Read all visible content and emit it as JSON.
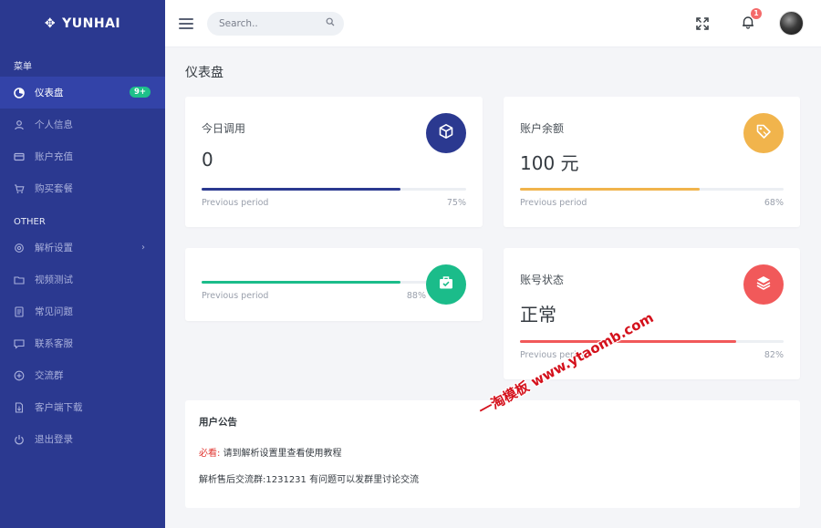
{
  "brand": {
    "name": "YUNHAI",
    "icon": "crosshair-icon"
  },
  "sidebar": {
    "section_menu": "菜单",
    "section_other": "OTHER",
    "menu_items": [
      {
        "label": "仪表盘",
        "icon": "dashboard-icon",
        "badge": "9+",
        "active": true
      },
      {
        "label": "个人信息",
        "icon": "user-icon"
      },
      {
        "label": "账户充值",
        "icon": "credit-card-icon"
      },
      {
        "label": "购买套餐",
        "icon": "cart-icon"
      }
    ],
    "other_items": [
      {
        "label": "解析设置",
        "icon": "gear-icon",
        "has_submenu": true
      },
      {
        "label": "视频测试",
        "icon": "video-icon"
      },
      {
        "label": "常见问题",
        "icon": "document-icon"
      },
      {
        "label": "联系客服",
        "icon": "chat-icon"
      },
      {
        "label": "交流群",
        "icon": "plus-circle-icon"
      },
      {
        "label": "客户端下载",
        "icon": "file-download-icon"
      },
      {
        "label": "退出登录",
        "icon": "power-icon"
      }
    ]
  },
  "topbar": {
    "search_placeholder": "Search..",
    "notification_count": "1"
  },
  "main": {
    "page_title": "仪表盘",
    "cards": [
      {
        "label": "今日调用",
        "value": "0",
        "period_label": "Previous period",
        "percent": "75%",
        "progress": 0.75,
        "color": "#2b3990",
        "icon": "cube-icon"
      },
      {
        "label": "账户余额",
        "value": "100 元",
        "period_label": "Previous period",
        "percent": "68%",
        "progress": 0.68,
        "color": "#f1b44c",
        "icon": "tag-icon"
      },
      {
        "label": "",
        "value": "",
        "period_label": "Previous period",
        "percent": "88%",
        "progress": 0.88,
        "color": "#1bbc8a",
        "icon": "briefcase-check-icon"
      },
      {
        "label": "账号状态",
        "value": "正常",
        "period_label": "Previous period",
        "percent": "82%",
        "progress": 0.82,
        "color": "#f1595a",
        "icon": "layers-icon"
      }
    ],
    "notice": {
      "title": "用户公告",
      "must_prefix": "必看:",
      "line1": "请到解析设置里查看使用教程",
      "line2": "解析售后交流群:1231231 有问题可以发群里讨论交流"
    }
  },
  "watermark": "一淘模板 www.ytaomb.com"
}
